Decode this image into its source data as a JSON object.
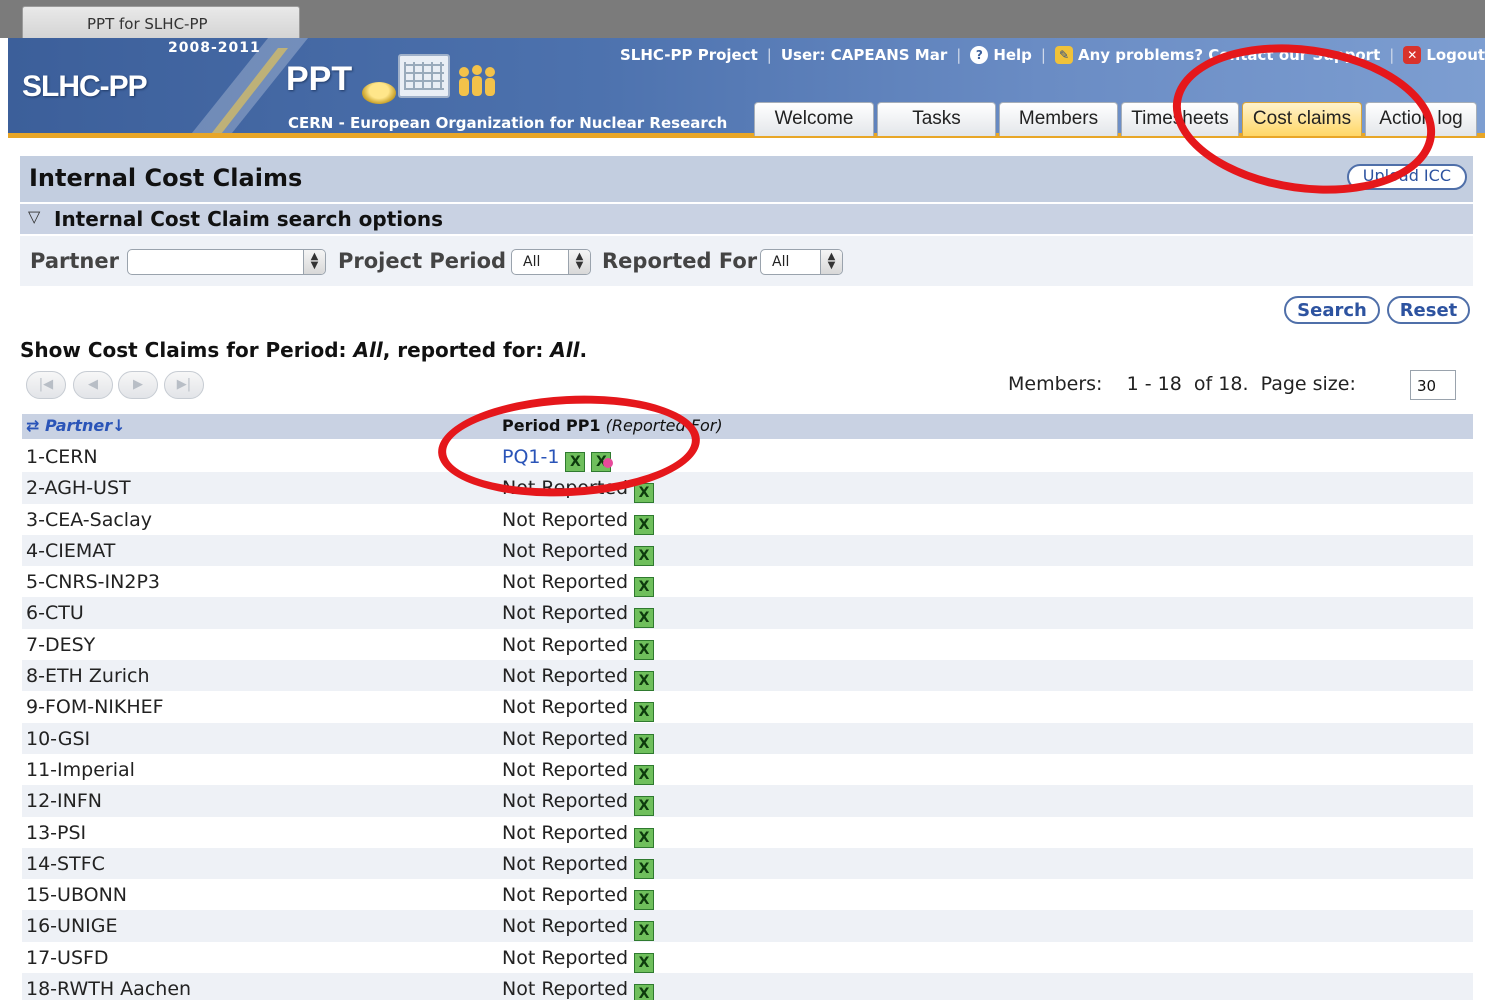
{
  "browser": {
    "tab_title": "PPT for SLHC-PP"
  },
  "header": {
    "years": "2008-2011",
    "logo_text": "SLHC-PP",
    "ppt_text": "PPT",
    "org_name": "CERN - European Organization for Nuclear Research",
    "links": {
      "project": "SLHC-PP Project",
      "user": "User: CAPEANS Mar",
      "help": "Help",
      "support": "Any problems? Contact our Support",
      "logout": "Logout"
    }
  },
  "nav": {
    "tabs": [
      {
        "label": "Welcome"
      },
      {
        "label": "Tasks"
      },
      {
        "label": "Members"
      },
      {
        "label": "Timesheets"
      },
      {
        "label": "Cost claims"
      },
      {
        "label": "Action log"
      }
    ],
    "active": "Cost claims"
  },
  "page": {
    "title": "Internal Cost Claims",
    "upload_label": "Upload ICC"
  },
  "search": {
    "title": "Internal Cost Claim search options",
    "partner_label": "Partner",
    "partner_value": "",
    "period_label": "Project Period",
    "period_value": "All",
    "reported_label": "Reported For",
    "reported_value": "All",
    "search_button": "Search",
    "reset_button": "Reset"
  },
  "results": {
    "show_prefix": "Show Cost Claims for Period: ",
    "period": "All",
    "mid": ", reported for: ",
    "reported": "All",
    "suffix": ".",
    "members_label": "Members:",
    "range": "1 - 18",
    "of_text": "of 18.",
    "page_size_label": "Page size:",
    "page_size": "30"
  },
  "table": {
    "col_partner": "Partner",
    "col_period_bold": "Period PP1",
    "col_period_italic": "(Reported For)",
    "rows": [
      {
        "partner": "1-CERN",
        "status": "PQ1-1"
      },
      {
        "partner": "2-AGH-UST",
        "status": "Not Reported"
      },
      {
        "partner": "3-CEA-Saclay",
        "status": "Not Reported"
      },
      {
        "partner": "4-CIEMAT",
        "status": "Not Reported"
      },
      {
        "partner": "5-CNRS-IN2P3",
        "status": "Not Reported"
      },
      {
        "partner": "6-CTU",
        "status": "Not Reported"
      },
      {
        "partner": "7-DESY",
        "status": "Not Reported"
      },
      {
        "partner": "8-ETH Zurich",
        "status": "Not Reported"
      },
      {
        "partner": "9-FOM-NIKHEF",
        "status": "Not Reported"
      },
      {
        "partner": "10-GSI",
        "status": "Not Reported"
      },
      {
        "partner": "11-Imperial",
        "status": "Not Reported"
      },
      {
        "partner": "12-INFN",
        "status": "Not Reported"
      },
      {
        "partner": "13-PSI",
        "status": "Not Reported"
      },
      {
        "partner": "14-STFC",
        "status": "Not Reported"
      },
      {
        "partner": "15-UBONN",
        "status": "Not Reported"
      },
      {
        "partner": "16-UNIGE",
        "status": "Not Reported"
      },
      {
        "partner": "17-USFD",
        "status": "Not Reported"
      },
      {
        "partner": "18-RWTH Aachen",
        "status": "Not Reported"
      }
    ]
  },
  "colors": {
    "banner": "#4d72ae",
    "accent_orange": "#e8a627",
    "link_blue": "#2a54b8",
    "annotation_red": "#e5171b",
    "excel_green": "#6fbf5c"
  },
  "icons": {
    "help": "question-circle-icon",
    "support": "support-icon",
    "logout": "close-x-icon",
    "toggle": "triangle-down-icon",
    "sort": "refresh-arrows-icon",
    "export": "excel-icon"
  }
}
